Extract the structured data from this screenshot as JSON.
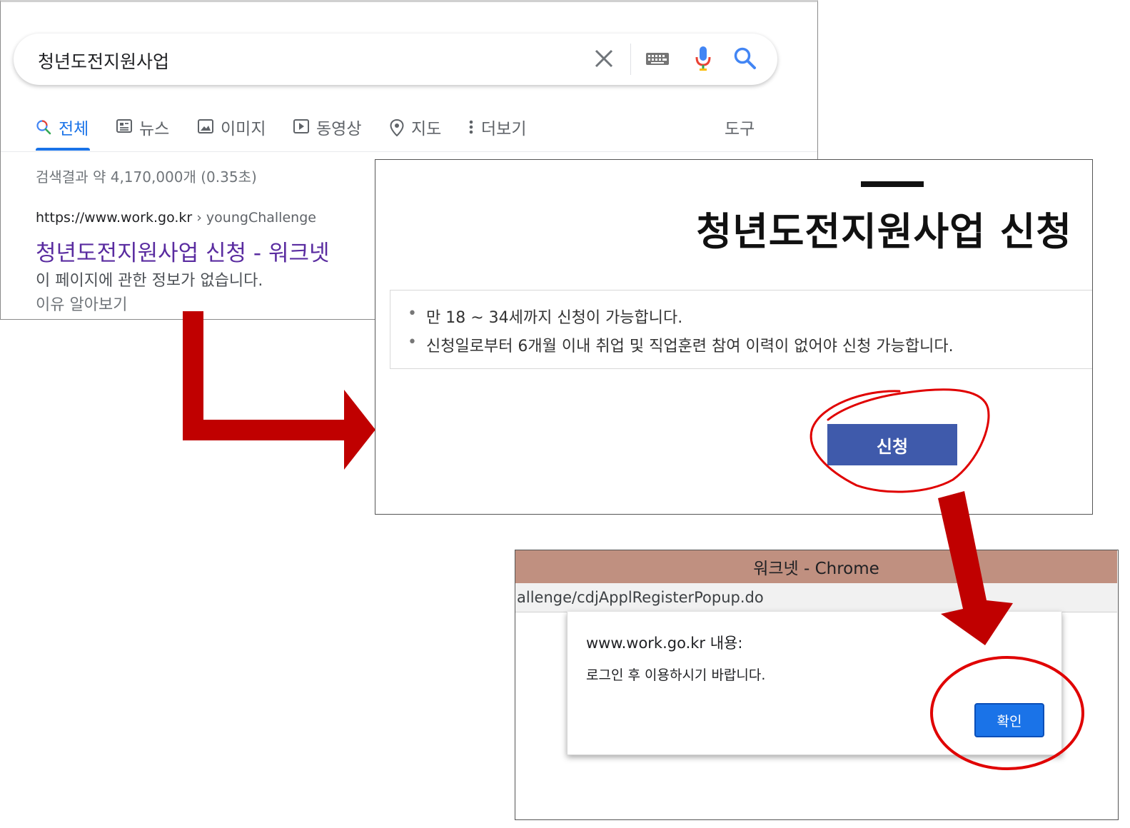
{
  "google": {
    "query": "청년도전지원사업",
    "tabs": [
      {
        "label": "전체",
        "icon": "search-icon",
        "active": true
      },
      {
        "label": "뉴스",
        "icon": "news-icon"
      },
      {
        "label": "이미지",
        "icon": "image-icon"
      },
      {
        "label": "동영상",
        "icon": "video-icon"
      },
      {
        "label": "지도",
        "icon": "map-pin-icon"
      },
      {
        "label": "더보기",
        "icon": "more-vert-icon"
      }
    ],
    "tools_label": "도구",
    "result_stats": "검색결과 약 4,170,000개 (0.35초)",
    "result": {
      "url": "https://www.work.go.kr",
      "breadcrumb": "› youngChallenge",
      "title": "청년도전지원사업 신청 - 워크넷",
      "snippet": "이 페이지에 관한 정보가 없습니다.",
      "more_link": "이유 알아보기"
    },
    "colors": {
      "accent": "#1a73e8",
      "visited_link": "#5a2ca0"
    }
  },
  "worknet": {
    "heading": "청년도전지원사업 신청",
    "info": [
      "만 18 ~ 34세까지 신청이 가능합니다.",
      "신청일로부터 6개월 이내 취업 및 직업훈련 참여 이력이 없어야 신청 가능합니다."
    ],
    "apply_label": "신청",
    "colors": {
      "button": "#3f5aab"
    }
  },
  "chrome_popup": {
    "window_title": "워크넷 - Chrome",
    "url": "allenge/cdjApplRegisterPopup.do",
    "alert": {
      "origin": "www.work.go.kr 내용:",
      "message": "로그인 후 이용하시기 바랍니다.",
      "ok_label": "확인"
    },
    "colors": {
      "titlebar": "#c09080",
      "ok_button": "#1a73e8"
    }
  },
  "annotations": {
    "arrow_color": "#c00000",
    "highlight_circle_color": "#e00000"
  }
}
